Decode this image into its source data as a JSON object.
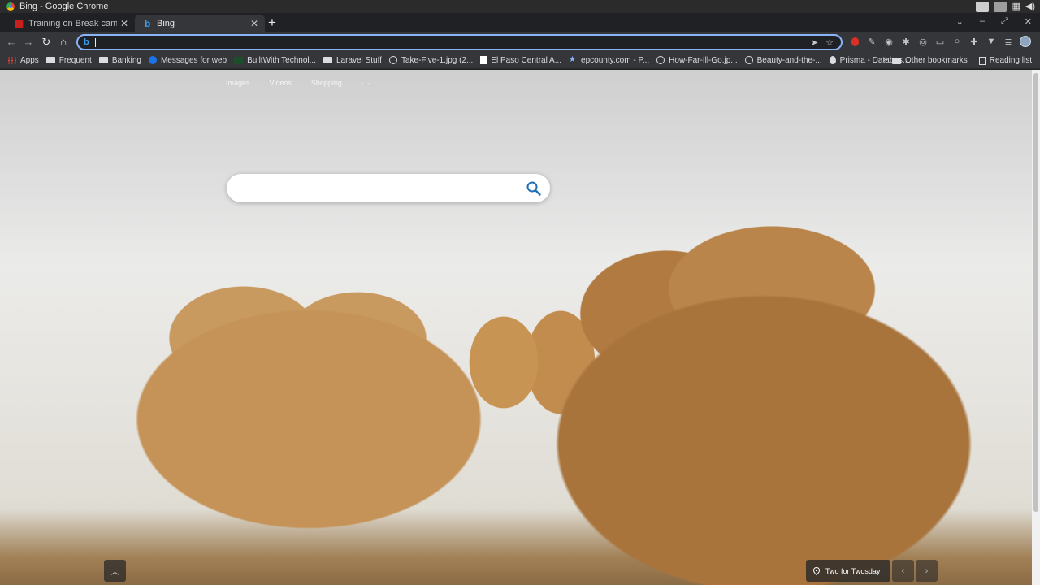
{
  "window": {
    "title": "Bing - Google Chrome"
  },
  "tabs": [
    {
      "title": "Training on Break camelCase",
      "active": false
    },
    {
      "title": "Bing",
      "active": true
    }
  ],
  "omnibox": {
    "value": "",
    "placeholder": ""
  },
  "bookmarks": [
    {
      "label": "Apps",
      "icon": "apps-grid-icon"
    },
    {
      "label": "Frequent",
      "icon": "folder-icon"
    },
    {
      "label": "Banking",
      "icon": "folder-icon"
    },
    {
      "label": "Messages for web",
      "icon": "messages-icon"
    },
    {
      "label": "BuiltWith Technol...",
      "icon": "builtwith-icon"
    },
    {
      "label": "Laravel Stuff",
      "icon": "folder-icon"
    },
    {
      "label": "Take-Five-1.jpg (2...",
      "icon": "globe-icon"
    },
    {
      "label": "El Paso Central A...",
      "icon": "document-icon"
    },
    {
      "label": "epcounty.com - P...",
      "icon": "star-icon"
    },
    {
      "label": "How-Far-Ill-Go.jp...",
      "icon": "globe-icon"
    },
    {
      "label": "Beauty-and-the-...",
      "icon": "globe-icon"
    },
    {
      "label": "Prisma - Databas...",
      "icon": "prisma-icon"
    }
  ],
  "bookmarks_right": {
    "other": "Other bookmarks",
    "reading": "Reading list"
  },
  "bing": {
    "nav": [
      "Images",
      "Videos",
      "Shopping",
      "· · ·"
    ],
    "search_value": "",
    "image_caption": "Two for Twosday"
  },
  "colors": {
    "accent": "#8ab4f8",
    "bing_blue": "#3aa0f0",
    "page_bg": "#e6e4df"
  }
}
